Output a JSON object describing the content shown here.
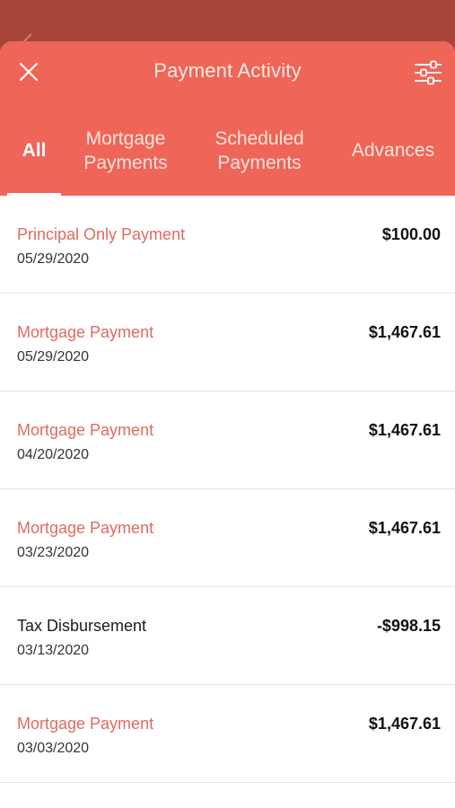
{
  "header": {
    "title": "Payment Activity",
    "close_icon": "close-icon",
    "filter_icon": "sliders-icon",
    "background": "#ef6557",
    "backdrop": "#a8453a"
  },
  "tabs": [
    {
      "label_line1": "All",
      "label_line2": "",
      "active": true
    },
    {
      "label_line1": "Mortgage",
      "label_line2": "Payments",
      "active": false
    },
    {
      "label_line1": "Scheduled",
      "label_line2": "Payments",
      "active": false
    },
    {
      "label_line1": "Advances",
      "label_line2": "",
      "active": false
    }
  ],
  "transactions": [
    {
      "description": "Principal Only Payment",
      "date": "05/29/2020",
      "amount": "$100.00",
      "type": "payment"
    },
    {
      "description": "Mortgage Payment",
      "date": "05/29/2020",
      "amount": "$1,467.61",
      "type": "payment"
    },
    {
      "description": "Mortgage Payment",
      "date": "04/20/2020",
      "amount": "$1,467.61",
      "type": "payment"
    },
    {
      "description": "Mortgage Payment",
      "date": "03/23/2020",
      "amount": "$1,467.61",
      "type": "payment"
    },
    {
      "description": "Tax Disbursement",
      "date": "03/13/2020",
      "amount": "-$998.15",
      "type": "disbursement"
    },
    {
      "description": "Mortgage Payment",
      "date": "03/03/2020",
      "amount": "$1,467.61",
      "type": "payment"
    }
  ],
  "colors": {
    "accent": "#ef6557",
    "payment_text": "#e06a5f",
    "neutral_text": "#1a1a1a"
  }
}
